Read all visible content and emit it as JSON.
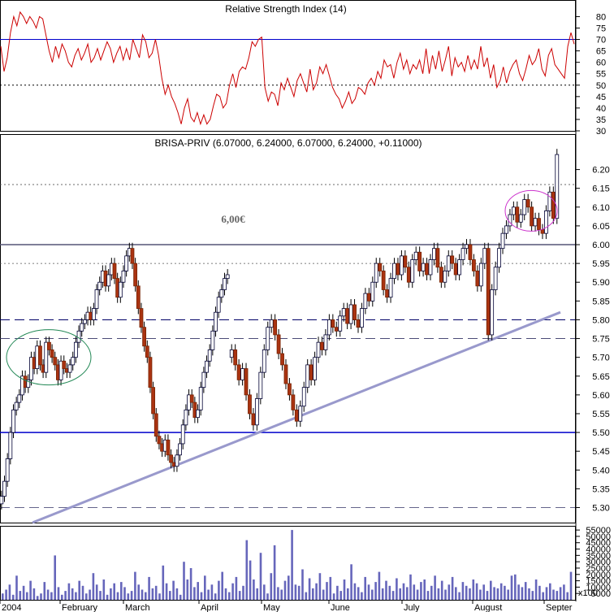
{
  "chart_data": [
    {
      "panel": "rsi",
      "type": "line",
      "title": "Relative Strength Index (14)",
      "y_ticks": [
        30,
        35,
        40,
        45,
        50,
        55,
        60,
        65,
        70,
        75,
        80
      ],
      "ylim": [
        30,
        83
      ],
      "reference_lines": [
        {
          "value": 70,
          "style": "solid",
          "color": "#0000cc"
        },
        {
          "value": 50,
          "style": "dotted",
          "color": "#000000"
        }
      ],
      "series": [
        {
          "color": "#cc0000",
          "values": [
            67,
            56,
            62,
            73,
            80,
            76,
            82,
            80,
            77,
            80,
            78,
            75,
            80,
            79,
            72,
            65,
            60,
            67,
            62,
            68,
            65,
            60,
            58,
            63,
            66,
            61,
            64,
            68,
            60,
            62,
            66,
            61,
            65,
            69,
            66,
            60,
            64,
            67,
            61,
            66,
            61,
            70,
            66,
            62,
            72,
            69,
            62,
            64,
            70,
            63,
            53,
            46,
            50,
            45,
            42,
            38,
            33,
            40,
            44,
            36,
            34,
            38,
            33,
            37,
            33,
            35,
            41,
            46,
            45,
            40,
            42,
            50,
            55,
            49,
            56,
            58,
            57,
            62,
            69,
            67,
            70,
            71,
            49,
            43,
            47,
            46,
            41,
            51,
            48,
            53,
            49,
            45,
            52,
            55,
            51,
            47,
            57,
            48,
            51,
            58,
            55,
            59,
            54,
            49,
            46,
            44,
            40,
            43,
            47,
            42,
            44,
            49,
            48,
            46,
            51,
            53,
            50,
            56,
            53,
            61,
            58,
            59,
            53,
            60,
            64,
            57,
            61,
            55,
            59,
            57,
            61,
            55,
            66,
            55,
            63,
            57,
            65,
            56,
            61,
            67,
            54,
            62,
            58,
            60,
            56,
            63,
            57,
            61,
            57,
            67,
            58,
            62,
            53,
            59,
            49,
            52,
            58,
            51,
            56,
            59,
            61,
            55,
            52,
            57,
            63,
            59,
            61,
            66,
            57,
            54,
            63,
            66,
            59,
            57,
            55,
            53,
            67,
            73,
            68
          ]
        }
      ]
    },
    {
      "panel": "price",
      "type": "candlestick",
      "title": "BRISA-PRIV (6.07000, 6.24000, 6.07000, 6.24000, +0.11000)",
      "y_ticks": [
        5.3,
        5.35,
        5.4,
        5.45,
        5.5,
        5.55,
        5.6,
        5.65,
        5.7,
        5.75,
        5.8,
        5.85,
        5.9,
        5.95,
        6.0,
        6.05,
        6.1,
        6.15,
        6.2
      ],
      "ylim": [
        5.26,
        6.29
      ],
      "annotations": [
        {
          "text": "6,00€"
        }
      ],
      "close": [
        5.33,
        5.37,
        5.43,
        5.5,
        5.56,
        5.58,
        5.6,
        5.65,
        5.62,
        5.64,
        5.7,
        5.67,
        5.73,
        5.68,
        5.66,
        5.74,
        5.72,
        5.7,
        5.68,
        5.64,
        5.69,
        5.67,
        5.66,
        5.68,
        5.7,
        5.74,
        5.77,
        5.79,
        5.8,
        5.82,
        5.8,
        5.83,
        5.88,
        5.9,
        5.93,
        5.89,
        5.92,
        5.95,
        5.91,
        5.86,
        5.9,
        5.93,
        5.97,
        5.99,
        5.95,
        5.89,
        5.83,
        5.78,
        5.73,
        5.7,
        5.62,
        5.55,
        5.49,
        5.47,
        5.45,
        5.48,
        5.44,
        5.42,
        5.41,
        5.44,
        5.47,
        5.52,
        5.56,
        5.6,
        5.58,
        5.54,
        5.56,
        5.62,
        5.66,
        5.69,
        5.72,
        5.77,
        5.82,
        5.86,
        5.88,
        5.91,
        5.92
      ],
      "close_2": [
        5.72,
        5.68,
        5.64,
        5.67,
        5.6,
        5.55,
        5.52,
        5.59,
        5.66,
        5.72,
        5.78,
        5.8,
        5.76,
        5.71,
        5.68,
        5.63,
        5.6,
        5.56,
        5.53,
        5.57,
        5.62,
        5.68,
        5.64,
        5.7,
        5.74,
        5.72,
        5.76,
        5.8,
        5.78,
        5.77,
        5.81,
        5.83,
        5.79,
        5.84,
        5.8,
        5.78,
        5.83,
        5.87,
        5.85,
        5.9,
        5.95,
        5.93,
        5.88,
        5.86,
        5.91,
        5.95,
        5.92,
        5.97,
        5.94,
        5.9,
        5.96,
        5.98,
        5.93,
        5.95,
        5.92,
        5.96,
        5.99,
        5.94,
        5.9,
        5.93,
        5.97,
        5.95,
        5.92,
        5.96,
        5.99,
        6.0,
        5.96,
        5.93,
        5.89,
        5.95,
        5.99,
        5.76,
        5.88,
        5.94,
        5.99,
        6.03,
        6.05,
        6.08,
        6.1,
        6.06,
        6.08,
        6.12,
        6.1,
        6.05,
        6.07,
        6.04,
        6.03,
        6.09,
        6.14,
        6.07,
        6.24
      ]
    },
    {
      "panel": "volume",
      "type": "bar",
      "title": "",
      "y_ticks": [
        5000,
        10000,
        15000,
        20000,
        25000,
        30000,
        35000,
        40000,
        45000,
        50000,
        55000
      ],
      "y_multiplier_label": "x100",
      "ylim": [
        0,
        57000
      ],
      "values": [
        5000,
        8000,
        12000,
        4000,
        19000,
        7000,
        11000,
        6000,
        15000,
        9000,
        3000,
        5000,
        14000,
        8000,
        6000,
        35000,
        10000,
        4000,
        7000,
        13000,
        9000,
        6000,
        15000,
        11000,
        5000,
        8000,
        21000,
        12000,
        7000,
        16000,
        4000,
        9000,
        13000,
        6000,
        14000,
        10000,
        5000,
        7000,
        22000,
        12000,
        8000,
        6000,
        18000,
        9000,
        11000,
        5000,
        27000,
        13000,
        7000,
        15000,
        9000,
        4000,
        30000,
        16000,
        25000,
        10000,
        14000,
        6000,
        19000,
        8000,
        12000,
        5000,
        15000,
        22000,
        9000,
        6000,
        13000,
        18000,
        7000,
        11000,
        47000,
        31000,
        16000,
        9000,
        37000,
        12000,
        5000,
        21000,
        43000,
        10000,
        8000,
        15000,
        19000,
        55000,
        12000,
        11000,
        24000,
        6000,
        17000,
        9000,
        13000,
        21000,
        8000,
        14000,
        18000,
        5000,
        11000,
        7000,
        16000,
        9000,
        28000,
        13000,
        10000,
        6000,
        18000,
        12000,
        8000,
        14000,
        22000,
        9000,
        15000,
        11000,
        7000,
        17000,
        9000,
        13000,
        10000,
        20000,
        12000,
        8000,
        14000,
        16000,
        7000,
        11000,
        19000,
        9000,
        15000,
        8000,
        12000,
        18000,
        10000,
        6000,
        14000,
        11000,
        9000,
        16000,
        13000,
        8000,
        12000,
        7000,
        15000,
        10000,
        9000,
        13000,
        11000,
        8000,
        19000,
        20000,
        12000,
        10000,
        14000,
        9000,
        7000,
        16000,
        11000,
        6000,
        10000,
        13000,
        8000,
        7000,
        10000,
        12000,
        6000,
        22000
      ]
    }
  ],
  "x_axis": {
    "labels": [
      "2004",
      "February",
      "March",
      "April",
      "May",
      "June",
      "July",
      "August",
      "Septer"
    ]
  }
}
